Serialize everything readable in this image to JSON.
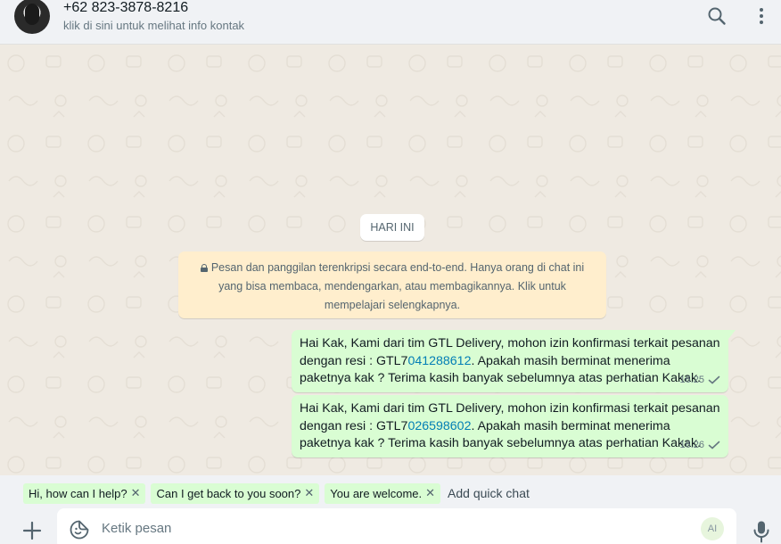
{
  "header": {
    "contact_name": "+62 823-3878-8216",
    "contact_sub": "klik di sini untuk melihat info kontak"
  },
  "chat": {
    "date_chip": "HARI INI",
    "encryption_notice": "Pesan dan panggilan terenkripsi secara end-to-end. Hanya orang di chat ini yang bisa membaca, mendengarkan, atau membagikannya. Klik untuk mempelajari selengkapnya.",
    "messages": [
      {
        "text_before": "Hai Kak, Kami dari tim GTL Delivery, mohon izin konfirmasi terkait pesanan dengan resi : GTL7",
        "resi_number": "041288612",
        "text_after": ". Apakah masih berminat menerima paketnya kak ? Terima kasih banyak sebelumnya atas perhatian Kakak.",
        "time": "16.25",
        "status": "sent"
      },
      {
        "text_before": "Hai Kak, Kami dari tim GTL Delivery, mohon izin konfirmasi terkait pesanan dengan resi : GTL7",
        "resi_number": "026598602",
        "text_after": ". Apakah masih berminat menerima paketnya kak ? Terima kasih banyak sebelumnya atas perhatian Kakak.",
        "time": "16.26",
        "status": "sent"
      }
    ]
  },
  "quick_replies": {
    "chips": [
      {
        "label": "Hi, how can I help?"
      },
      {
        "label": "Can I get back to you soon?"
      },
      {
        "label": "You are welcome."
      }
    ],
    "add_label": "Add quick chat",
    "remove_glyph": "✕"
  },
  "composer": {
    "placeholder": "Ketik pesan",
    "ai_label": "AI"
  },
  "colors": {
    "outgoing_bubble": "#d9fdd3",
    "notice_bg": "#ffeecd",
    "chat_bg": "#efeae2",
    "header_bg": "#f0f2f5",
    "link": "#027eb5"
  }
}
